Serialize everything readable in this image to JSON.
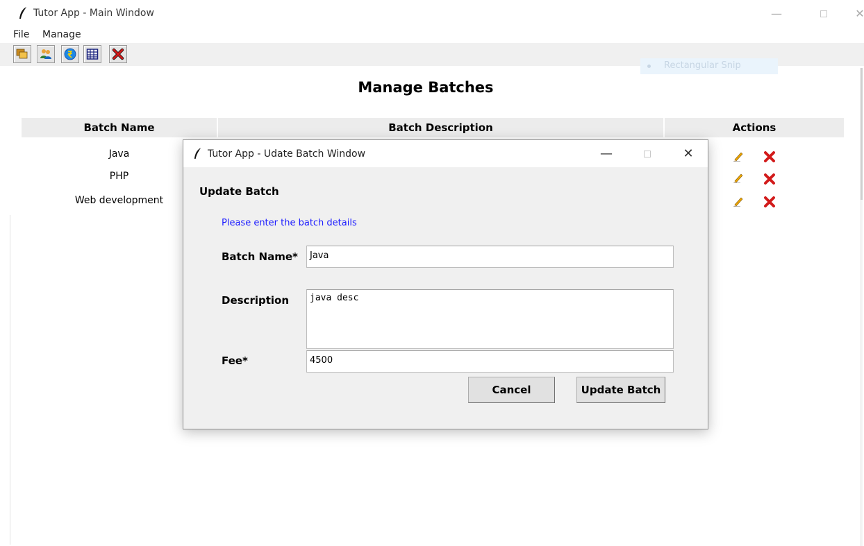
{
  "main_window": {
    "title": "Tutor App - Main Window",
    "min_glyph": "—",
    "close_glyph": "✕"
  },
  "menu": {
    "file": "File",
    "manage": "Manage"
  },
  "toolbar": {
    "buttons": [
      {
        "icon": "batches-icon"
      },
      {
        "icon": "students-icon"
      },
      {
        "icon": "fees-icon"
      },
      {
        "icon": "table-icon"
      },
      {
        "icon": "exit-icon"
      }
    ]
  },
  "snip_overlay": {
    "label": "Rectangular Snip"
  },
  "page": {
    "heading": "Manage Batches"
  },
  "table": {
    "columns": [
      "Batch Name",
      "Batch Description",
      "Actions"
    ],
    "rows": [
      {
        "name": "Java"
      },
      {
        "name": "PHP"
      },
      {
        "name": "Web development"
      }
    ]
  },
  "colors": {
    "delete": "#d21a1a",
    "hint": "#1c1cff"
  },
  "dialog": {
    "title": "Tutor App - Udate Batch Window",
    "min_glyph": "—",
    "close_glyph": "✕",
    "heading": "Update Batch",
    "hint": "Please enter the batch details",
    "labels": {
      "name": "Batch Name*",
      "description": "Description",
      "fee": "Fee*"
    },
    "values": {
      "name": "Java",
      "description": "java desc",
      "fee": "4500"
    },
    "buttons": {
      "cancel": "Cancel",
      "update": "Update Batch"
    }
  }
}
